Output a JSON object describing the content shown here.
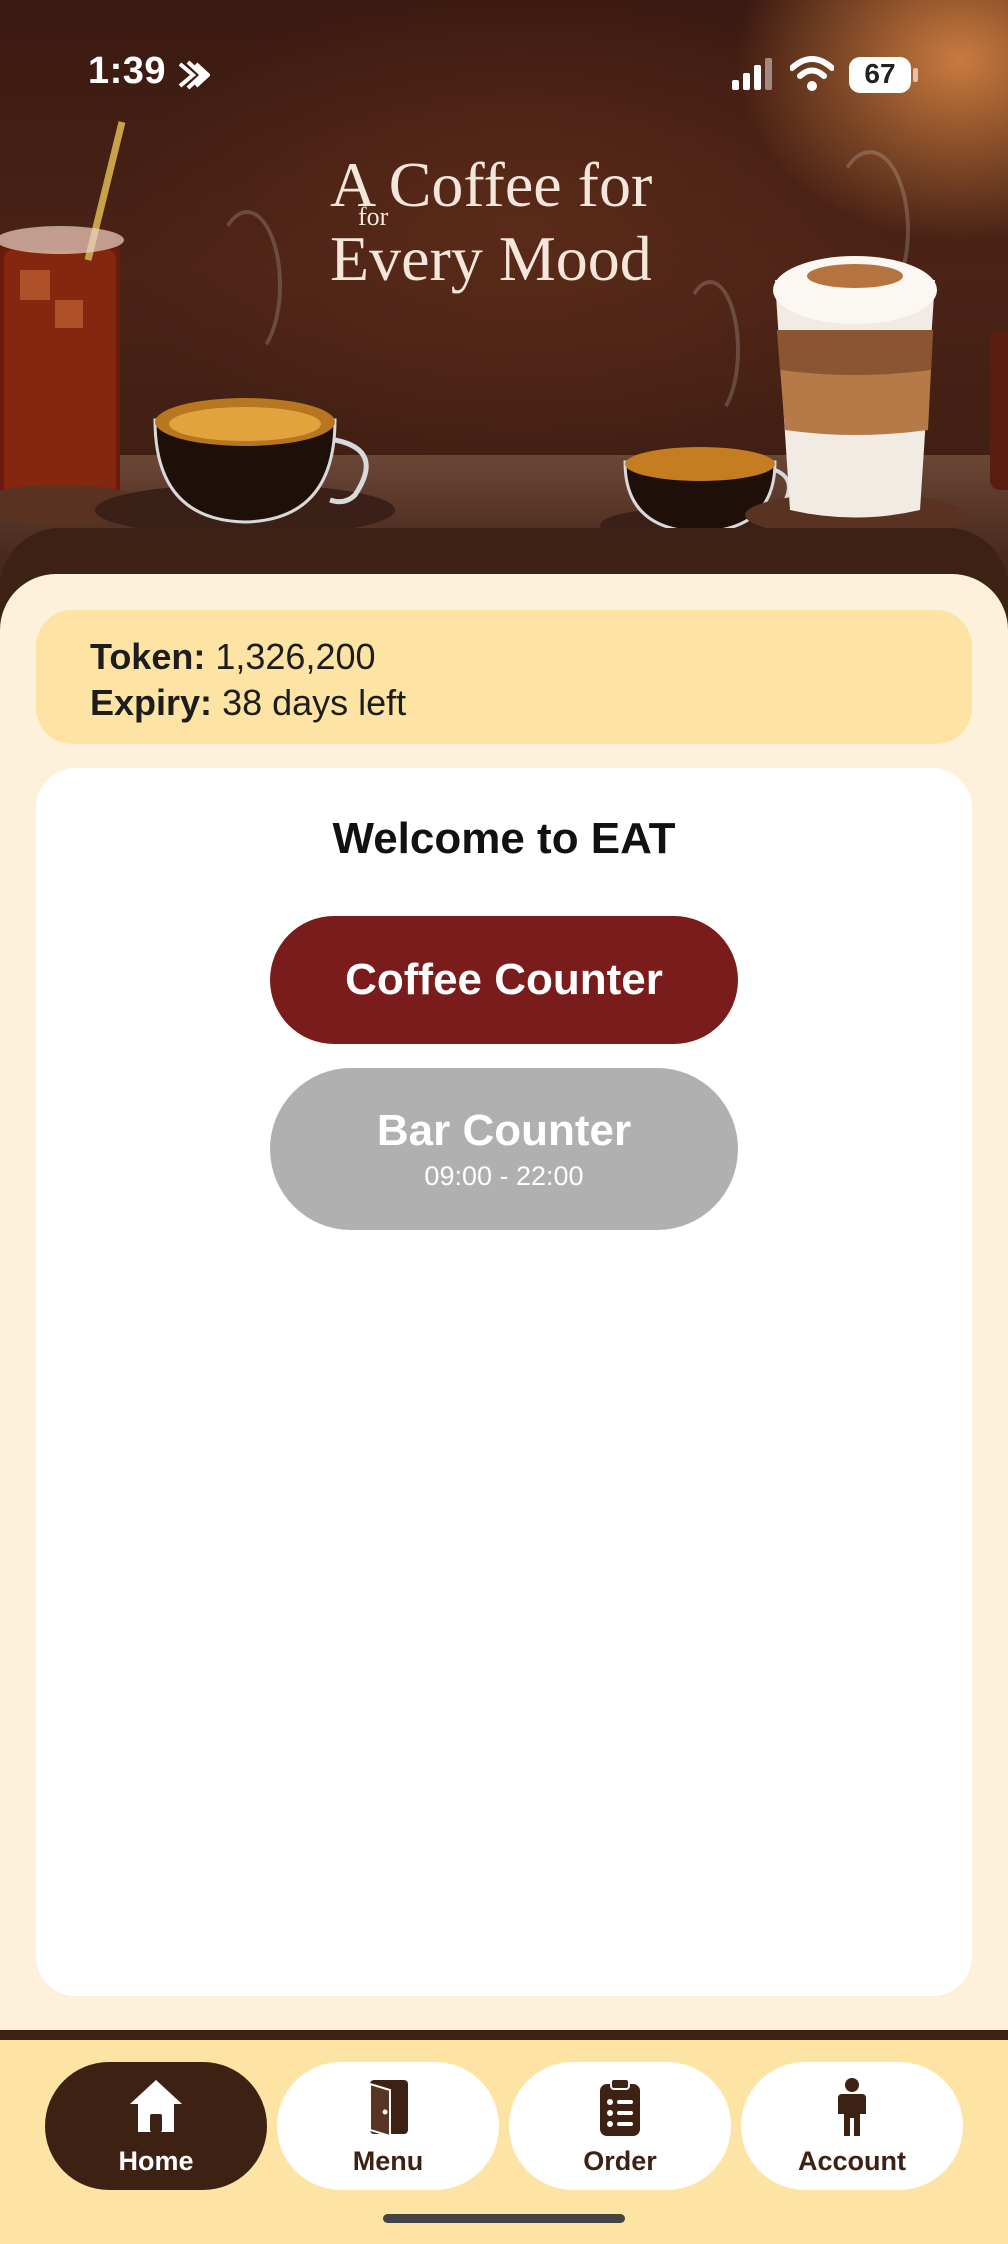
{
  "status_bar": {
    "time": "1:39",
    "battery": "67",
    "icons": [
      "signal-icon",
      "wifi-icon",
      "battery-icon",
      "notification-icon"
    ]
  },
  "hero": {
    "title_line1": "A Coffee for",
    "title_for": "for",
    "title_line2": "Every Mood"
  },
  "token_card": {
    "token_label": "Token:",
    "token_value": "1,326,200",
    "expiry_label": "Expiry:",
    "expiry_value": "38 days left"
  },
  "main": {
    "welcome": "Welcome to EAT",
    "coffee_counter": "Coffee Counter",
    "bar_counter": "Bar Counter",
    "bar_counter_hours": "09:00 - 22:00"
  },
  "nav": {
    "items": [
      {
        "label": "Home",
        "icon": "home-icon",
        "active": true
      },
      {
        "label": "Menu",
        "icon": "book-icon",
        "active": false
      },
      {
        "label": "Order",
        "icon": "clipboard-icon",
        "active": false
      },
      {
        "label": "Account",
        "icon": "person-icon",
        "active": false
      }
    ]
  },
  "colors": {
    "accent_dark": "#3d2214",
    "coffee_button": "#7a1c1c",
    "disabled_button": "#b0b0b0",
    "token_card_bg": "#fde4a4",
    "page_bg": "#fdf1dc"
  }
}
